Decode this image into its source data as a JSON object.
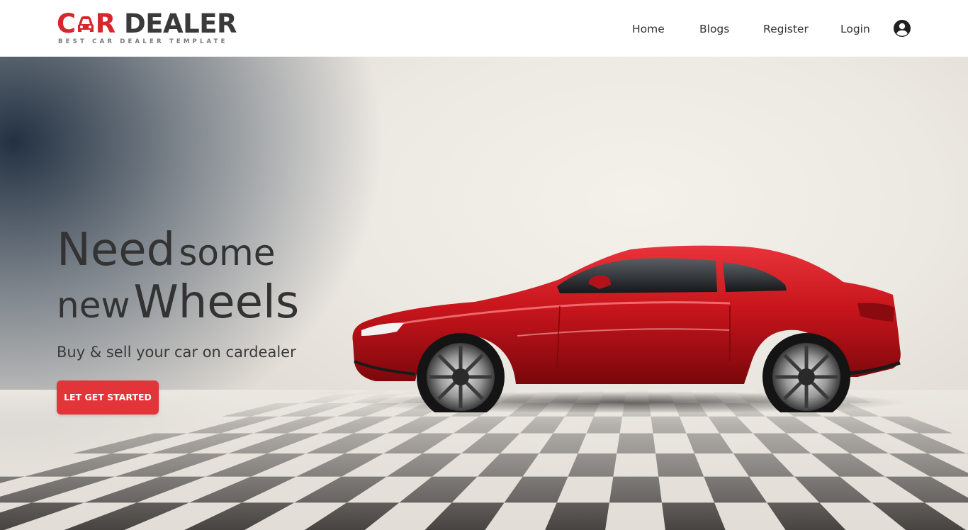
{
  "brand": {
    "name_red": "C",
    "name_red2": "R",
    "name_dark": "DEALER",
    "tagline": "BEST CAR DEALER TEMPLATE",
    "accent_color": "#d8262d"
  },
  "nav": {
    "items": [
      {
        "label": "Home"
      },
      {
        "label": "Blogs"
      },
      {
        "label": "Register"
      },
      {
        "label": "Login"
      }
    ],
    "user_icon": "user-circle-icon"
  },
  "hero": {
    "headline_big1": "Need",
    "headline_small1": "some",
    "headline_small2": "new",
    "headline_big2": "Wheels",
    "subtitle": "Buy & sell your car on cardealer",
    "cta_label": "LET GET STARTED",
    "cta_color": "#e3343a",
    "car_color": "#c8151c"
  }
}
